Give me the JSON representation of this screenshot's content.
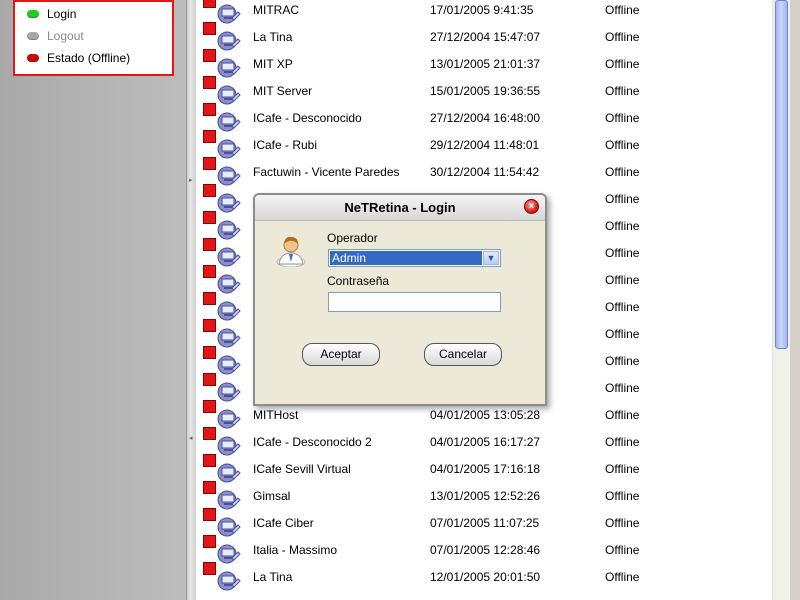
{
  "status_panel": {
    "items": [
      {
        "label": "Login",
        "led_color": "#1fcc1f"
      },
      {
        "label": "Logout",
        "led_color": "#a8a8a8"
      },
      {
        "label": "Estado (Offline)",
        "led_color": "#cc0a0a"
      }
    ]
  },
  "computers": [
    {
      "name": "MITRAC",
      "last": "17/01/2005 9:41:35",
      "status": "Offline"
    },
    {
      "name": "La Tina",
      "last": "27/12/2004 15:47:07",
      "status": "Offline"
    },
    {
      "name": "MIT XP",
      "last": "13/01/2005 21:01:37",
      "status": "Offline"
    },
    {
      "name": "MIT Server",
      "last": "15/01/2005 19:36:55",
      "status": "Offline"
    },
    {
      "name": "ICafe - Desconocido",
      "last": "27/12/2004 16:48:00",
      "status": "Offline"
    },
    {
      "name": "ICafe - Rubi",
      "last": "29/12/2004 11:48:01",
      "status": "Offline"
    },
    {
      "name": "Factuwin - Vicente Paredes",
      "last": "30/12/2004 11:54:42",
      "status": "Offline"
    },
    {
      "name": "",
      "last": "",
      "status": "Offline"
    },
    {
      "name": "",
      "last": "",
      "status": "Offline"
    },
    {
      "name": "",
      "last": "",
      "status": "Offline"
    },
    {
      "name": "",
      "last": "",
      "status": "Offline"
    },
    {
      "name": "",
      "last": "",
      "status": "Offline"
    },
    {
      "name": "",
      "last": "",
      "status": "Offline"
    },
    {
      "name": "",
      "last": "",
      "status": "Offline"
    },
    {
      "name": "",
      "last": "",
      "status": "Offline"
    },
    {
      "name": "MITHost",
      "last": "04/01/2005 13:05:28",
      "status": "Offline"
    },
    {
      "name": "ICafe - Desconocido 2",
      "last": "04/01/2005 16:17:27",
      "status": "Offline"
    },
    {
      "name": "ICafe Sevill Virtual",
      "last": "04/01/2005 17:16:18",
      "status": "Offline"
    },
    {
      "name": "Gimsal",
      "last": "13/01/2005 12:52:26",
      "status": "Offline"
    },
    {
      "name": "ICafe Ciber",
      "last": "07/01/2005 11:07:25",
      "status": "Offline"
    },
    {
      "name": "Italia - Massimo",
      "last": "07/01/2005 12:28:46",
      "status": "Offline"
    },
    {
      "name": "La Tina",
      "last": "12/01/2005 20:01:50",
      "status": "Offline"
    }
  ],
  "login_dialog": {
    "title": "NeTRetina - Login",
    "operator_label": "Operador",
    "operator_value": "Admin",
    "password_label": "Contraseña",
    "password_value": "",
    "accept_label": "Aceptar",
    "cancel_label": "Cancelar",
    "close_glyph": "×"
  },
  "icons": {
    "flag": "red-flag-icon",
    "computer": "network-computer-icon",
    "operator": "user-icon",
    "dropdown": "chevron-down-icon"
  }
}
